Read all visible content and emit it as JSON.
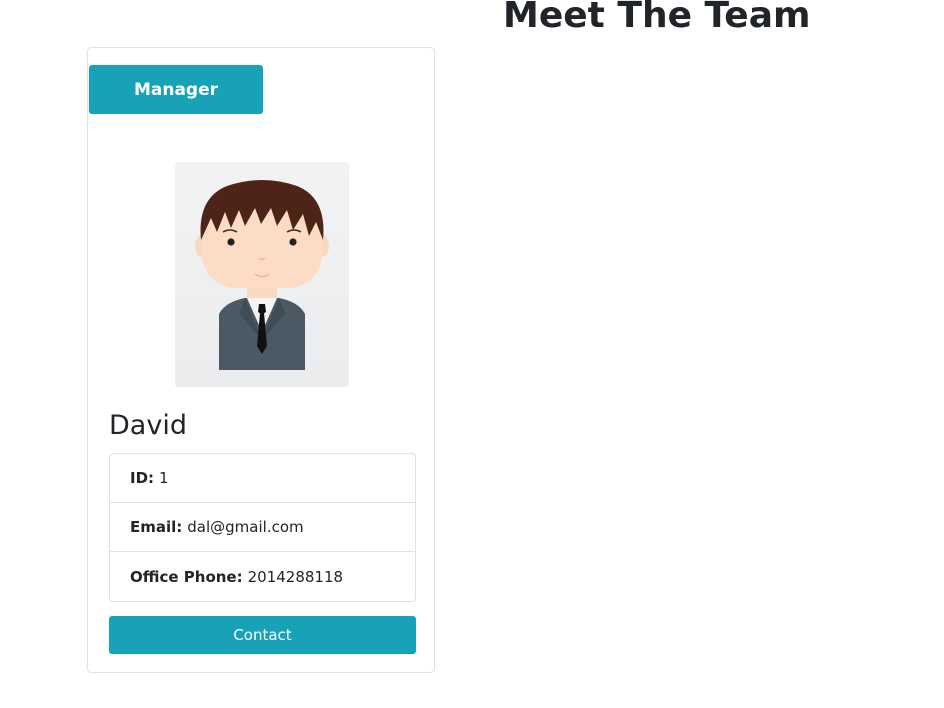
{
  "page": {
    "title": "Meet The Team"
  },
  "colors": {
    "accent": "#17a2b8"
  },
  "card": {
    "role": "Manager",
    "avatar_icon": "cartoon-businessman-avatar",
    "name": "David",
    "details": [
      {
        "label": "ID:",
        "value": "1"
      },
      {
        "label": "Email:",
        "value": "dal@gmail.com"
      },
      {
        "label": "Office Phone:",
        "value": "2014288118"
      }
    ],
    "contact_label": "Contact"
  }
}
